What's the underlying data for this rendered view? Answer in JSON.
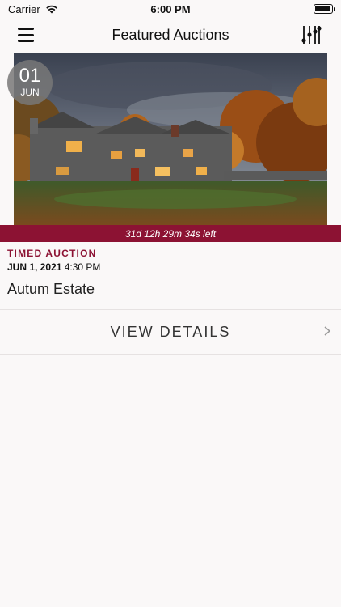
{
  "status_bar": {
    "carrier": "Carrier",
    "time": "6:00 PM"
  },
  "header": {
    "title": "Featured Auctions",
    "menu_icon": "hamburger-menu-icon",
    "filter_icon": "sliders-filter-icon"
  },
  "auction": {
    "date_badge": {
      "day": "01",
      "month": "JUN"
    },
    "time_left": "31d 12h 29m 34s left",
    "type": "TIMED AUCTION",
    "date": "JUN 1, 2021",
    "time": "4:30 PM",
    "title": "Autum Estate",
    "view_details_label": "VIEW DETAILS"
  },
  "colors": {
    "accent": "#8c1233",
    "background": "#faf8f8"
  }
}
